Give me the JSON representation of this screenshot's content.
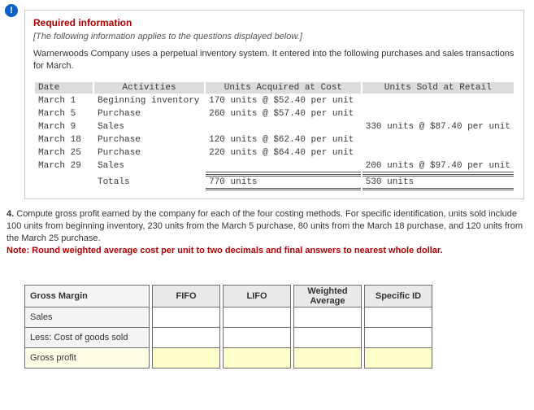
{
  "alert_glyph": "!",
  "required": {
    "title": "Required information",
    "subtitle": "[The following information applies to the questions displayed below.]",
    "body": "Warnerwoods Company uses a perpetual inventory system. It entered into the following purchases and sales transactions for March."
  },
  "ledger": {
    "headers": {
      "date": "Date",
      "activities": "Activities",
      "acquired": "Units Acquired at Cost",
      "sold": "Units Sold at Retail"
    },
    "rows": [
      {
        "date": "March 1",
        "act": "Beginning inventory",
        "acq": "170 units @ $52.40 per unit",
        "sold": ""
      },
      {
        "date": "March 5",
        "act": "Purchase",
        "acq": "260 units @ $57.40 per unit",
        "sold": ""
      },
      {
        "date": "March 9",
        "act": "Sales",
        "acq": "",
        "sold": "330 units @ $87.40 per unit"
      },
      {
        "date": "March 18",
        "act": "Purchase",
        "acq": "120 units @ $62.40 per unit",
        "sold": ""
      },
      {
        "date": "March 25",
        "act": "Purchase",
        "acq": "220 units @ $64.40 per unit",
        "sold": ""
      },
      {
        "date": "March 29",
        "act": "Sales",
        "acq": "",
        "sold": "200 units @ $97.40 per unit"
      }
    ],
    "totals": {
      "label": "Totals",
      "acq": "770 units",
      "sold": "530 units"
    }
  },
  "question": {
    "num": "4.",
    "text": " Compute gross profit earned by the company for each of the four costing methods. For specific identification, units sold include 100 units from beginning inventory, 230 units from the March 5 purchase, 80 units from the March 18 purchase, and 120 units from the March 25 purchase.",
    "note": "Note: Round weighted average cost per unit to two decimals and final answers to nearest whole dollar."
  },
  "answer_headers": {
    "gm": "Gross Margin",
    "fifo": "FIFO",
    "lifo": "LIFO",
    "wavg": "Weighted Average",
    "spid": "Specific ID"
  },
  "answer_rows": {
    "sales": "Sales",
    "cogs": "Less: Cost of goods sold",
    "gp": "Gross profit"
  }
}
